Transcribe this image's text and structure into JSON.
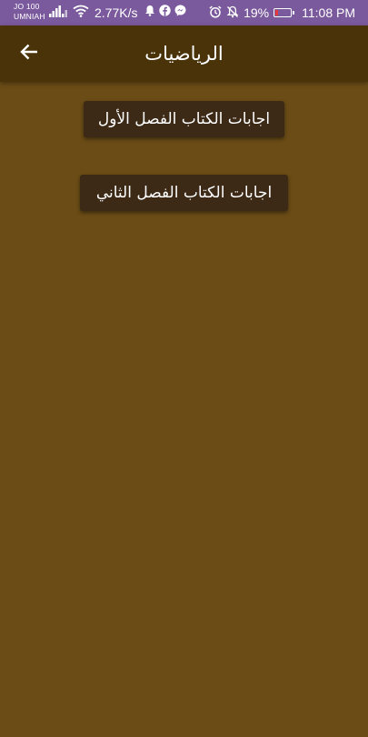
{
  "status_bar": {
    "carrier_line1": "JO 100",
    "carrier_line2": "UMNIAH",
    "network_speed": "2.77K/s",
    "battery_percent": "19%",
    "time": "11:08 PM",
    "icons": [
      "signal-icon",
      "wifi-icon",
      "notification-bell-icon",
      "facebook-icon",
      "messenger-icon",
      "alarm-icon",
      "mute-bell-icon",
      "battery-icon"
    ]
  },
  "app_bar": {
    "title": "الرياضيات",
    "back_icon": "arrow-back-icon"
  },
  "buttons": [
    {
      "label": "اجابات الكتاب الفصل الأول"
    },
    {
      "label": "اجابات الكتاب الفصل الثاني"
    }
  ],
  "colors": {
    "background": "#6b4c16",
    "app_bar": "#4a3209",
    "status_bar": "#7a5a9c",
    "button": "#3c2a17",
    "text": "#ffffff"
  }
}
